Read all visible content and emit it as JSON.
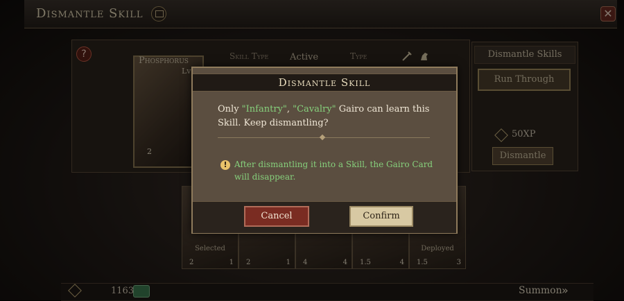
{
  "header": {
    "title": "Dismantle Skill"
  },
  "panel": {
    "card_name": "Phosphorus",
    "card_lv": "Lv",
    "card_count": "2",
    "skill_type_label": "Skill Type",
    "skill_type_value": "Active",
    "type_label": "Type",
    "type_icons": [
      "sword-icon",
      "horse-icon"
    ]
  },
  "right_panel": {
    "title": "Dismantle Skills",
    "run_through": "Run Through",
    "xp": "50XP",
    "dismantle": "Dismantle"
  },
  "cards": [
    {
      "label": "Selected",
      "left": "2",
      "right": "1"
    },
    {
      "label": "",
      "left": "2",
      "right": "1"
    },
    {
      "label": "",
      "left": "4",
      "right": "4"
    },
    {
      "label": "",
      "left": "1.5",
      "right": "4"
    },
    {
      "label": "Deployed",
      "left": "1.5",
      "right": "3"
    }
  ],
  "bottom": {
    "coins": "1163",
    "summon": "Summon"
  },
  "modal": {
    "title": "Dismantle Skill",
    "msg_pre": "Only ",
    "msg_inf": "\"Infantry\"",
    "msg_sep": ", ",
    "msg_cav": "\"Cavalry\"",
    "msg_post": " Gairo can learn this Skill. Keep dismantling?",
    "warning": "After dismantling it into a Skill, the Gairo Card will disappear.",
    "cancel": "Cancel",
    "confirm": "Confirm"
  },
  "colors": {
    "highlight": "#86d07c",
    "cancel": "#7a2c22",
    "confirm": "#d8c9a3"
  }
}
